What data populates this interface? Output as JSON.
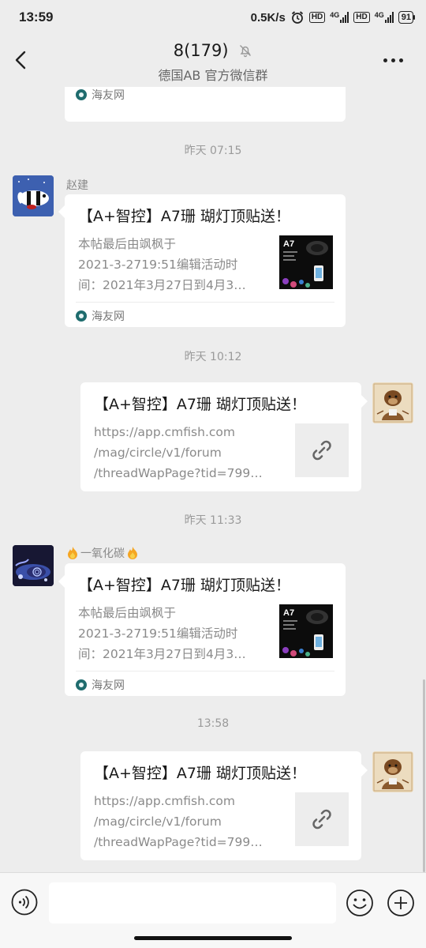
{
  "status": {
    "time": "13:59",
    "net_speed": "0.5K/s",
    "battery": "91",
    "hd_label": "HD",
    "net_type": "4G"
  },
  "header": {
    "title": "8(179)",
    "subtitle": "德国AB  官方微信群"
  },
  "messages": {
    "m0": {
      "source": "海友网"
    },
    "t1": "昨天 07:15",
    "m1": {
      "sender": "赵建",
      "title": "【A+智控】A7珊 瑚灯顶贴送！",
      "desc": [
        "本帖最后由飒枫于",
        "2021-3-2719:51编辑活动时",
        "间：2021年3月27日到4月3…"
      ],
      "source": "海友网",
      "thumb_label": "A7"
    },
    "t2": "昨天 10:12",
    "m2": {
      "title": "【A+智控】A7珊 瑚灯顶贴送！",
      "desc": [
        "https://app.cmfish.com",
        "/mag/circle/v1/forum",
        "/threadWapPage?tid=799…"
      ]
    },
    "t3": "昨天 11:33",
    "m3": {
      "sender": "一氧化碳",
      "title": "【A+智控】A7珊 瑚灯顶贴送！",
      "desc": [
        "本帖最后由飒枫于",
        "2021-3-2719:51编辑活动时",
        "间：2021年3月27日到4月3…"
      ],
      "source": "海友网",
      "thumb_label": "A7"
    },
    "t4": "13:58",
    "m4": {
      "title": "【A+智控】A7珊 瑚灯顶贴送！",
      "desc": [
        "https://app.cmfish.com",
        "/mag/circle/v1/forum",
        "/threadWapPage?tid=799…"
      ]
    }
  },
  "input": {
    "value": ""
  },
  "colors": {
    "background": "#ededed",
    "bubble": "#ffffff",
    "source_icon": "#1f6c6e"
  },
  "icons": [
    "back-arrow-icon",
    "bell-muted-icon",
    "more-icon",
    "link-icon",
    "voice-icon",
    "emoji-icon",
    "plus-icon",
    "fire-icon"
  ]
}
